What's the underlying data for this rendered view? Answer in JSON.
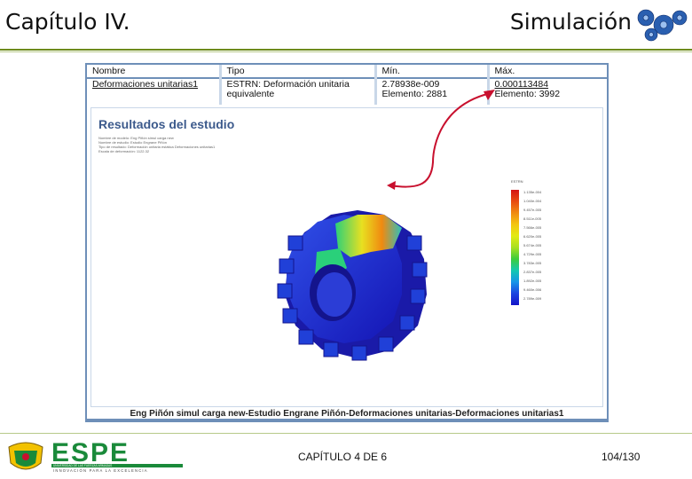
{
  "header": {
    "left_title": "Capítulo IV.",
    "right_title": "Simulación"
  },
  "table": {
    "headers": [
      "Nombre",
      "Tipo",
      "Mín.",
      "Máx."
    ],
    "row": {
      "nombre": "Deformaciones unitarias1",
      "tipo_line1": "ESTRN: Deformación unitaria",
      "tipo_line2": "equivalente",
      "min_value": "2.78938e-009",
      "min_elem": "Elemento: 2881",
      "max_value": "0.000113484",
      "max_elem": "Elemento: 3992"
    }
  },
  "results": {
    "title": "Resultados del estudio",
    "meta_lines": [
      "Nombre de modelo: Eng Piñón simul carga new",
      "Nombre de estudio: Estudio Engrane Piñón",
      "Tipo de resultado: Deformación unitaria estática Deformaciones unitarias1",
      "Escala de deformación: 1122.32"
    ],
    "legend_title": "ESTRN",
    "legend_labels": [
      "1.135e-004",
      "1.040e-004",
      "9.457e-005",
      "8.511e-005",
      "7.566e-005",
      "6.620e-005",
      "5.674e-005",
      "4.729e-005",
      "3.783e-005",
      "2.837e-005",
      "1.892e-005",
      "9.460e-006",
      "2.789e-009"
    ],
    "caption": "Eng Piñón simul carga new-Estudio Engrane Piñón-Deformaciones unitarias-Deformaciones unitarias1"
  },
  "colors": {
    "accent_green": "#6d8a1c",
    "frame_blue": "#6e8fb8",
    "arrow_red": "#c8102e",
    "espe_green": "#1a8a3a"
  },
  "footer": {
    "brand": "ESPE",
    "university_line": "UNIVERSIDAD DE LAS FUERZAS ARMADAS",
    "motto": "INNOVACIÓN PARA LA EXCELENCIA",
    "chapter": "CAPÍTULO 4 DE 6",
    "page": "104/130"
  }
}
